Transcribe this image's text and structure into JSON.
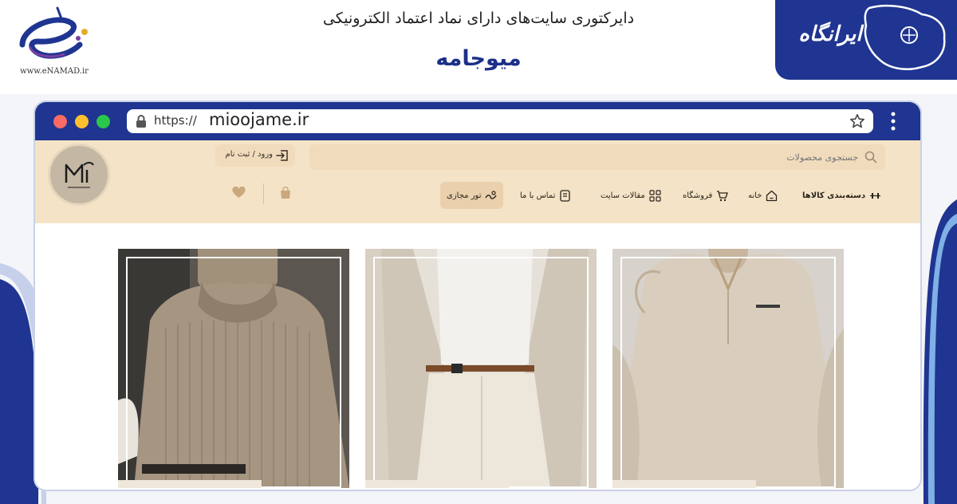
{
  "header": {
    "directory_title": "دایرکتوری سایت‌های دارای نماد اعتماد الکترونیکی",
    "site_name": "میوجامه",
    "enamad_text": "www.eNAMAD.ir",
    "brand_badge_text": "ایرانگاه"
  },
  "browser": {
    "url_prefix": "https://",
    "url_domain": "mioojame.ir"
  },
  "site": {
    "search_placeholder": "جستجوی محصولات",
    "login_label": "ورود / ثبت نام",
    "nav": {
      "categories": "دسته‌بندی کالاها",
      "home": "خانه",
      "shop": "فروشگاه",
      "articles": "مقالات سایت",
      "contact": "تماس با ما",
      "virtual_tour": "تور مجازی"
    }
  },
  "products": {
    "items": [
      {
        "name": "turtleneck-sweater"
      },
      {
        "name": "cream-suit-outfit"
      },
      {
        "name": "beige-hoodie"
      }
    ]
  },
  "colors": {
    "brand_blue": "#1f3591",
    "header_beige": "#f4e3c6",
    "search_beige": "#f0dcbd",
    "tour_highlight": "#ead0ad"
  },
  "icons": {
    "enamad": "enamad-logo-icon",
    "lock": "lock-icon",
    "star": "star-icon",
    "search": "search-icon",
    "login": "login-icon",
    "cart": "cart-icon",
    "wishlist": "heart-icon"
  }
}
